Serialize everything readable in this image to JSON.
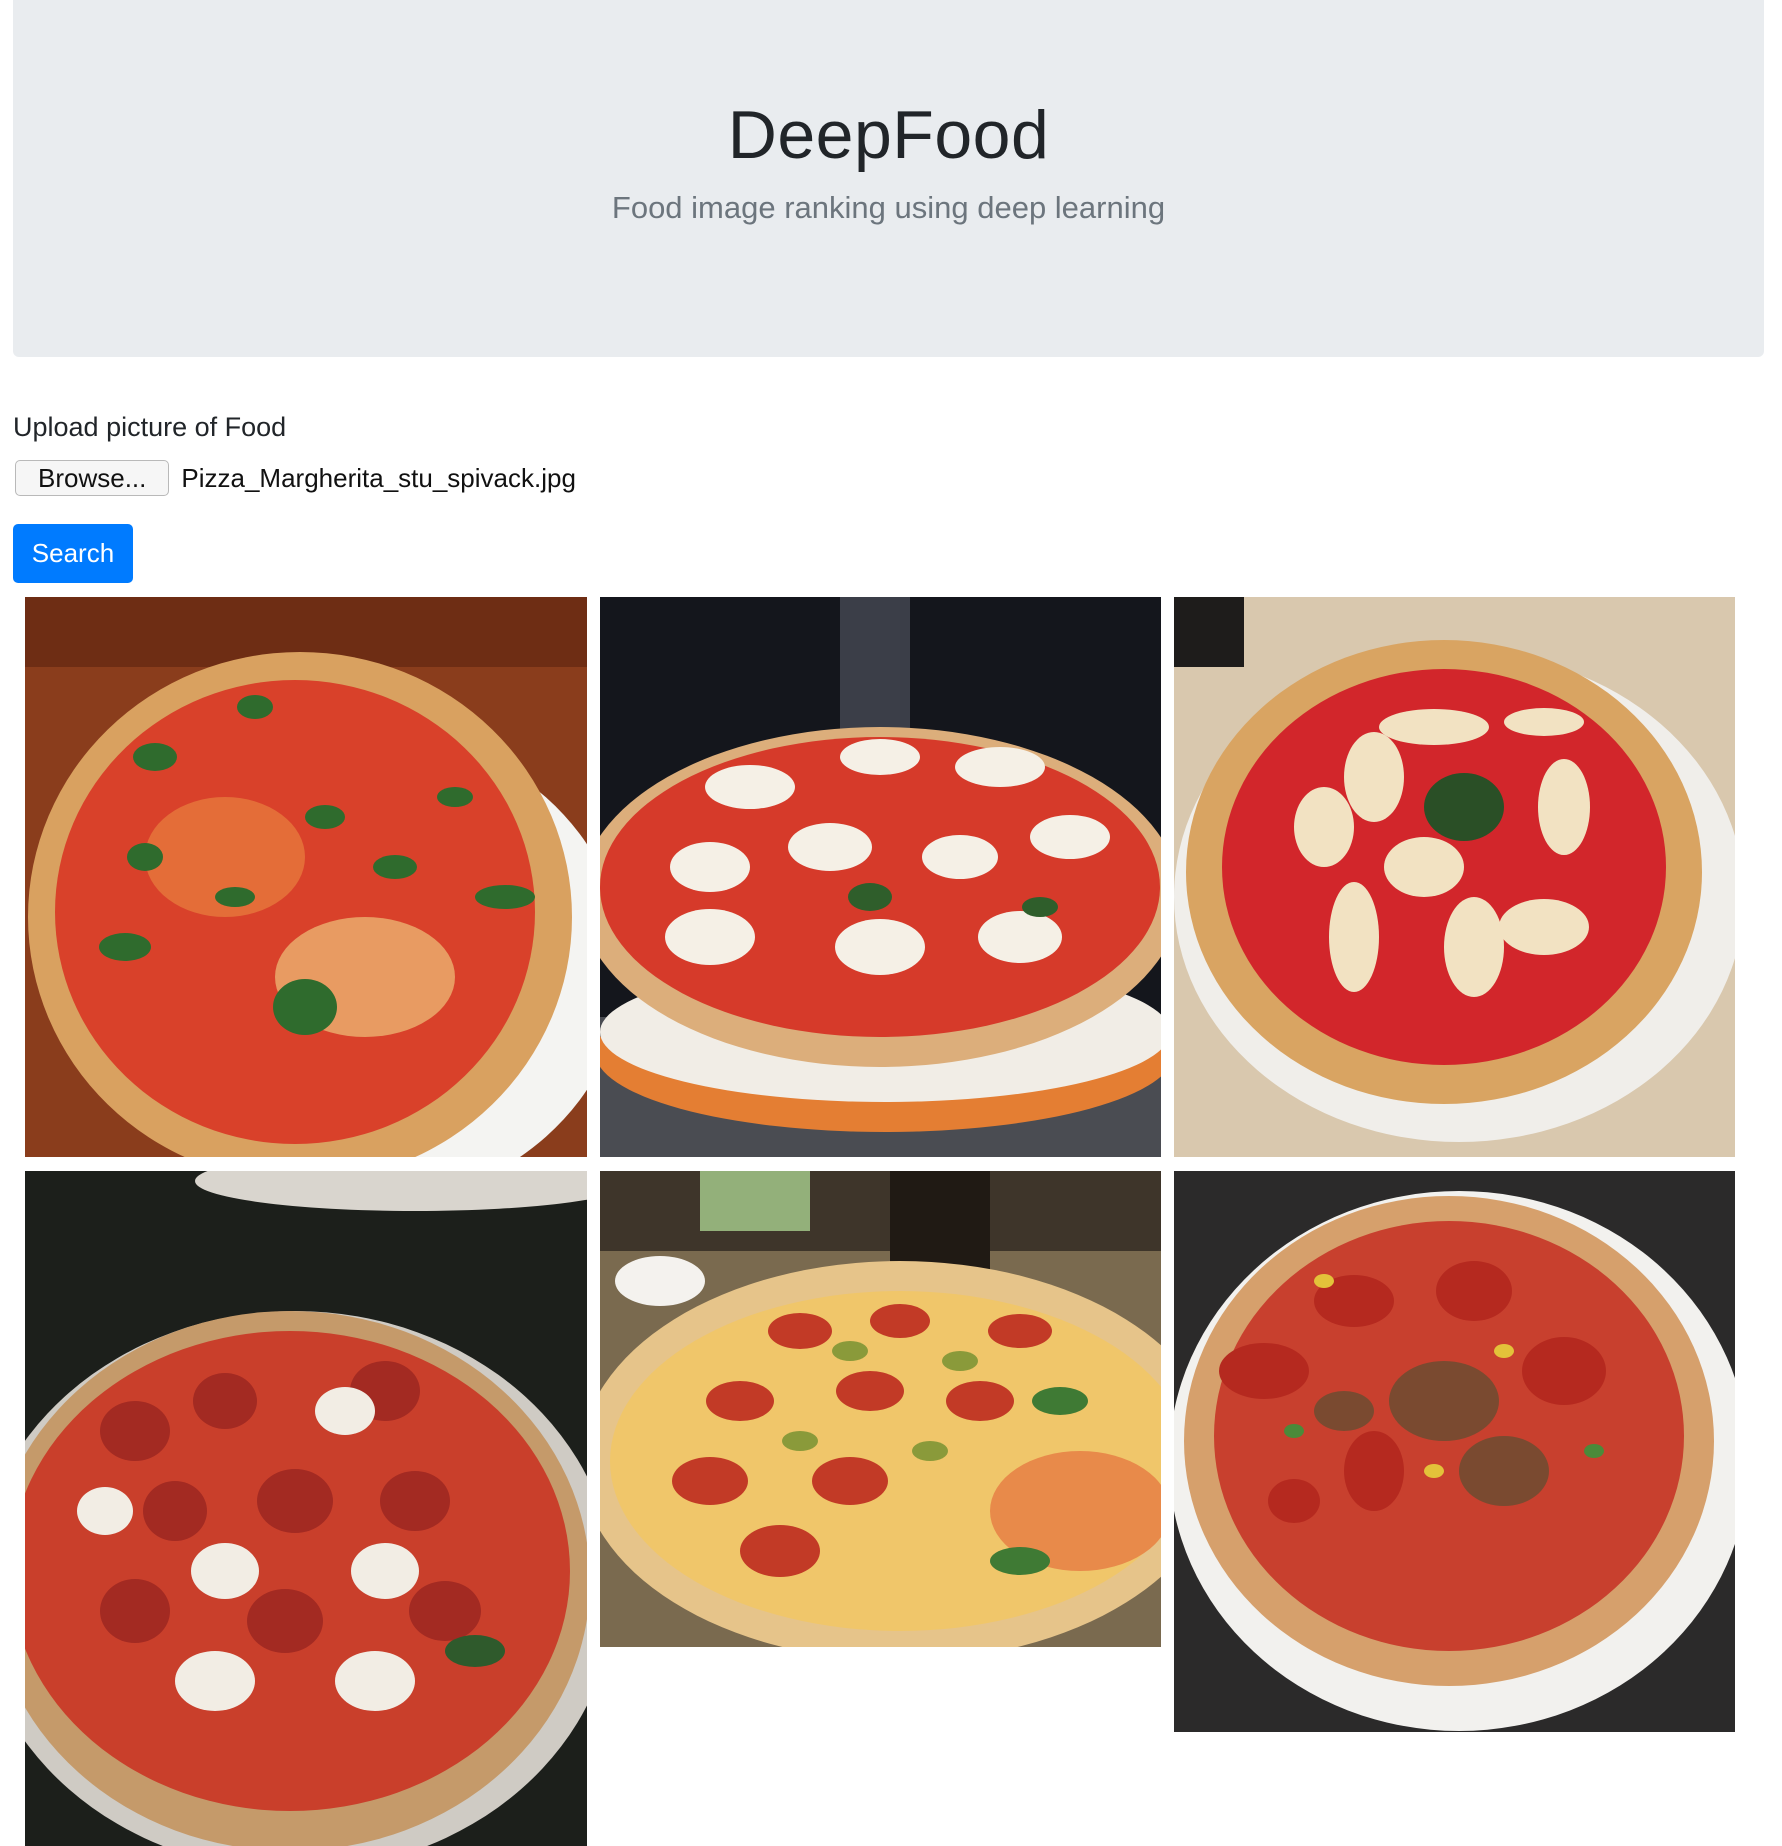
{
  "header": {
    "title": "DeepFood",
    "subtitle": "Food image ranking using deep learning"
  },
  "upload": {
    "label": "Upload picture of Food",
    "browse_label": "Browse...",
    "file_name": "Pizza_Margherita_stu_spivack.jpg"
  },
  "search": {
    "button_label": "Search"
  },
  "results": [
    {
      "image": "margherita-pizza-basil-wood-table",
      "alt": "Pizza result 1"
    },
    {
      "image": "margherita-pizza-mozzarella-dark-background",
      "alt": "Pizza result 2"
    },
    {
      "image": "margherita-pizza-tomato-sauce-white-plate",
      "alt": "Pizza result 3"
    },
    {
      "image": "pepperoni-margherita-pizza",
      "alt": "Pizza result 4"
    },
    {
      "image": "pepperoni-olive-pizza",
      "alt": "Pizza result 5"
    },
    {
      "image": "salami-vegetable-pizza-white-plate",
      "alt": "Pizza result 6"
    }
  ]
}
